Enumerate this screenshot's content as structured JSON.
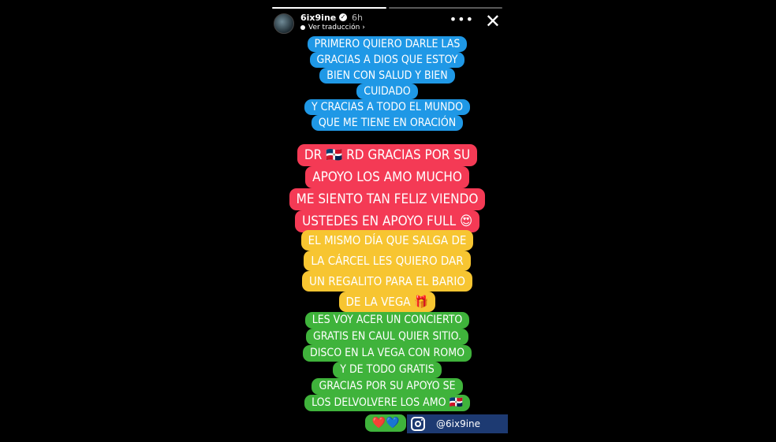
{
  "story": {
    "progress_segments": 2,
    "user": {
      "username": "6ix9ine",
      "verified_mark": "✓",
      "time_ago": "6h",
      "translate_label": "Ver traducción",
      "translate_chevron": "›"
    },
    "controls": {
      "more_label": "•••",
      "close_label": "✕"
    },
    "blocks": {
      "blue": [
        "PRIMERO QUIERO DARLE LAS",
        "GRACIAS A DIOS QUE ESTOY",
        "BIEN CON SALUD Y BIEN",
        "CUIDADO",
        "Y CRACIAS A TODO EL MUNDO",
        "QUE ME TIENE EN ORACIÓN"
      ],
      "red": [
        "DR 🇩🇴 RD GRACIAS POR SU",
        "APOYO LOS AMO MUCHO",
        "ME SIENTO TAN FELIZ VIENDO",
        "USTEDES EN APOYO FULL 😍"
      ],
      "yellow": [
        "EL MISMO DÍA QUE SALGA DE",
        "LA CÁRCEL LES QUIERO DAR",
        "UN REGALITO PARA EL BARIO",
        "DE LA VEGA 🎁"
      ],
      "green": [
        "LES VOY ACER UN CONCIERTO",
        "GRATIS EN CAUL QUIER SITIO.",
        "DISCO EN LA VEGA CON ROMO",
        "Y DE TODO GRATIS",
        "GRACIAS POR SU APOYO SE",
        "LOS DELVOLVERE LOS AMO 🇩🇴"
      ],
      "hearts": "❤️💙"
    },
    "watermark": {
      "icon": "instagram-icon",
      "handle": "@6ix9ine"
    },
    "colors": {
      "blue": "#1f98e6",
      "red": "#f43a55",
      "yellow": "#f7c531",
      "green": "#3fb33b",
      "badge": "#1d3a72"
    }
  }
}
